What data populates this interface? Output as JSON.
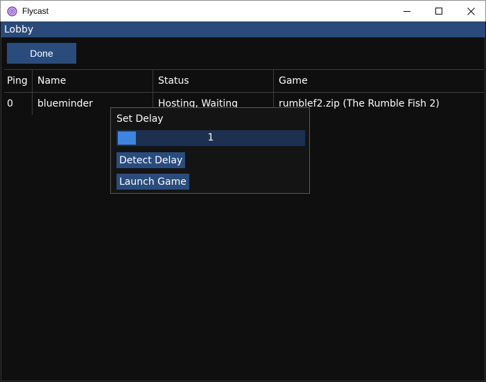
{
  "window": {
    "title": "Flycast"
  },
  "lobby": {
    "title": "Lobby",
    "done_label": "Done"
  },
  "table": {
    "headers": [
      "Ping",
      "Name",
      "Status",
      "Game"
    ],
    "rows": [
      [
        "0",
        "blueminder",
        "Hosting, Waiting",
        "rumblef2.zip (The Rumble Fish 2)"
      ]
    ]
  },
  "popup": {
    "title": "Set Delay",
    "delay_value": "1",
    "detect_label": "Detect Delay",
    "launch_label": "Launch Game"
  },
  "colors": {
    "accent": "#294a7a",
    "button": "#2a4c7d",
    "slider_grab": "#3d85e0",
    "background": "#0f0f0f"
  }
}
